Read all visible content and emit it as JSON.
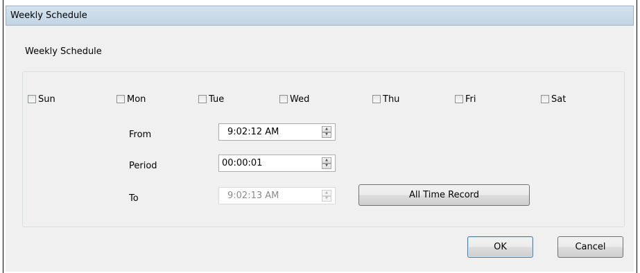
{
  "window": {
    "title": "Weekly Schedule"
  },
  "section_label": "Weekly Schedule",
  "days": [
    {
      "label": "Sun",
      "checked": false
    },
    {
      "label": "Mon",
      "checked": false
    },
    {
      "label": "Tue",
      "checked": false
    },
    {
      "label": "Wed",
      "checked": false
    },
    {
      "label": "Thu",
      "checked": false
    },
    {
      "label": "Fri",
      "checked": false
    },
    {
      "label": "Sat",
      "checked": false
    }
  ],
  "from": {
    "label": "From",
    "value": "9:02:12 AM"
  },
  "period": {
    "label": "Period",
    "value": "00:00:01"
  },
  "to": {
    "label": "To",
    "value": "9:02:13 AM",
    "enabled": false
  },
  "buttons": {
    "all_time_record": "All Time Record",
    "ok": "OK",
    "cancel": "Cancel"
  },
  "icons": {
    "spin_up": "▲",
    "spin_down": "▼"
  },
  "colors": {
    "title_bar": "#c9daea",
    "dialog_bg": "#f0f0f0",
    "default_button_border": "#3c7fb1"
  }
}
